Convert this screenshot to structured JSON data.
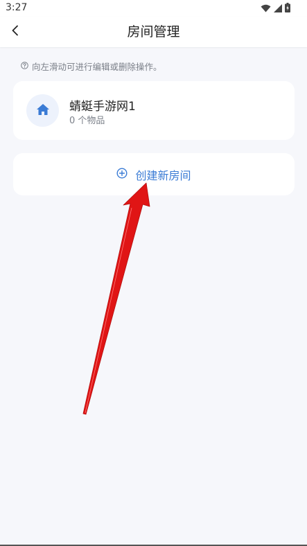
{
  "status_bar": {
    "time": "3:27",
    "icons": [
      "wifi-icon",
      "signal-icon",
      "battery-icon"
    ]
  },
  "app_bar": {
    "title": "房间管理",
    "back_icon": "chevron-left-icon"
  },
  "hint": {
    "icon": "question-circle-icon",
    "text": "向左滑动可进行编辑或删除操作。"
  },
  "rooms": [
    {
      "icon": "home-icon",
      "name": "蜻蜓手游网1",
      "count": "0 个物品"
    }
  ],
  "create_room": {
    "icon": "plus-circle-icon",
    "label": "创建新房间"
  },
  "annotation": {
    "type": "red-arrow",
    "points_to": "create-room-button"
  },
  "colors": {
    "accent": "#3a7bd5",
    "background": "#f6f7fb",
    "card": "#ffffff",
    "icon_bg": "#edf2fc",
    "arrow": "#e01515",
    "muted_text": "#7a7f88"
  }
}
